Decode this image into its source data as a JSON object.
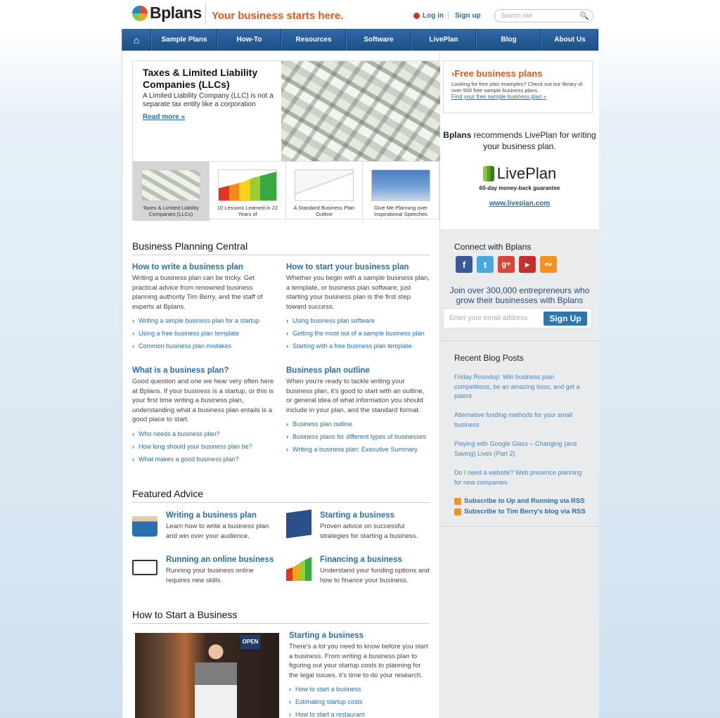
{
  "header": {
    "brand": "Bplans",
    "tagline": "Your business starts here.",
    "login": "Log in",
    "signup": "Sign up",
    "search_placeholder": "Search site"
  },
  "nav": [
    "Sample Plans",
    "How-To",
    "Resources",
    "Software",
    "LivePlan",
    "Blog",
    "About Us"
  ],
  "feature": {
    "title": "Taxes & Limited Liability Companies (LLCs)",
    "desc": "A Limited Liability Company (LLC) is not a separate tax entity like a corporation",
    "more": "Read more »",
    "thumbs": [
      "Taxes & Limited Liability Companies (LLCs)",
      "10 Lessons Learned in 22 Years of",
      "A Standard Business Plan Outline",
      "Give Me Planning over Inspirational Speeches"
    ]
  },
  "bpc": {
    "title": "Business Planning Central",
    "cols": [
      {
        "h": "How to write a business plan",
        "p": "Writing a business plan can be tricky. Get practical advice from renowned business planning authority Tim Berry, and the staff of experts at Bplans.",
        "links": [
          "Writing a simple business plan for a startup",
          "Using a free business plan template",
          "Common business plan mistakes"
        ]
      },
      {
        "h": "How to start your business plan",
        "p": "Whether you begin with a sample business plan, a template, or business plan software, just starting your business plan is the first step toward success.",
        "links": [
          "Using business plan software",
          "Getting the most out of a sample business plan",
          "Starting with a free business plan template"
        ]
      },
      {
        "h": "What is a business plan?",
        "p": "Good question and one we hear very often here at Bplans. If your business is a startup, or this is your first time writing a business plan, understanding what a business plan entails is a good place to start.",
        "links": [
          "Who needs a business plan?",
          "How long should your business plan be?",
          "What makes a good business plan?"
        ]
      },
      {
        "h": "Business plan outline",
        "p": "When you're ready to tackle writing your business plan, it's good to start with an outline, or general idea of what information you should include in your plan, and the standard format.",
        "links": [
          "Business plan outline",
          "Business plans for different types of businesses",
          "Writing a business plan: Executive Summary"
        ]
      }
    ]
  },
  "advice": {
    "title": "Featured Advice",
    "items": [
      {
        "h": "Writing a business plan",
        "p": "Learn how to write a business plan and win over your audience."
      },
      {
        "h": "Starting a business",
        "p": "Proven advice on successful strategies for starting a business."
      },
      {
        "h": "Running an online business",
        "p": "Running your business online requires new skills."
      },
      {
        "h": "Financing a business",
        "p": "Understand your funding options and how to finance your business."
      }
    ]
  },
  "howto": {
    "title": "How to Start a Business",
    "h": "Starting a business",
    "p": "There's a lot you need to know before you start a business. From writing a business plan to figuring out your startup costs to planning for the legal issues, it's time to do your research.",
    "links": [
      "How to start a business",
      "Estimating startup costs",
      "How to start a restaurant"
    ],
    "sign": "OPEN"
  },
  "sidebar": {
    "fbp": {
      "title": "Free business plans",
      "arrow": "›",
      "desc": "Looking for free plan examples? Check out our library of over 500 free sample business plans.",
      "link": "Find your free sample business plan »"
    },
    "liveplan": {
      "rec_brand": "Bplans",
      "rec_text": " recommends LivePlan for writing your business plan.",
      "logo": "LivePlan",
      "guarantee": "60-day money-back guarantee",
      "url": "www.liveplan.com"
    },
    "connect": "Connect with Bplans",
    "join": "Join over 300,000 entrepreneurs who grow their businesses with Bplans",
    "email_placeholder": "Enter your email address",
    "signup_btn": "Sign Up",
    "recent_title": "Recent Blog Posts",
    "posts": [
      "Friday Roundup: Win business plan competitions, be an amazing boss, and get a patent",
      "Alternative funding methods for your small business",
      "Playing with Google Glass – Changing (and Saving) Lives (Part 2)",
      "Do I need a website? Web presence planning for new companies"
    ],
    "rss": [
      "Subscribe to Up and Running via RSS",
      "Subscribe to Tim Berry's blog via RSS"
    ]
  }
}
